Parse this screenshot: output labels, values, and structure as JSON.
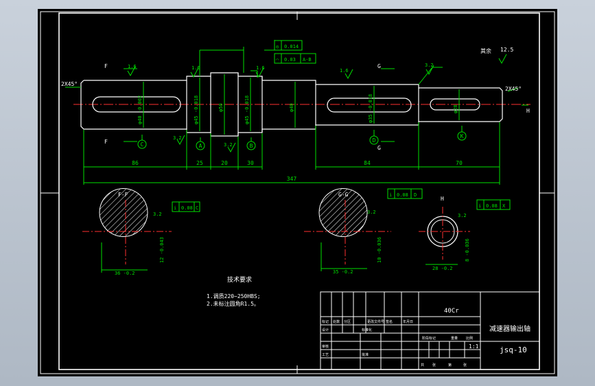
{
  "drawing": {
    "part_name": "减速器输出轴",
    "material": "40Cr",
    "drawing_no": "jsq-10",
    "scale": "1:1",
    "surface_finish_rest": "其余",
    "surface_finish_rest_value": "12.5",
    "tech_requirements_title": "技术要求",
    "tech_requirements": [
      "1.调质220~250HBS;",
      "2.未标注圆角R1.5。"
    ]
  },
  "front_view": {
    "chamfer_left": "2X45°",
    "chamfer_right": "2X45°",
    "diameters": [
      "φ40 -0.002",
      "φ45 -0.018",
      "φ50",
      "φ45 -0.018",
      "φ40",
      "φ35 -0.018",
      "φ28"
    ],
    "dim_lengths": [
      "86",
      "25",
      "20",
      "30",
      "84",
      "70"
    ],
    "dim_total": "347",
    "roughness_values": [
      "1.6",
      "1.6",
      "1.6",
      "1.6",
      "3.2",
      "3.2",
      "3.2"
    ],
    "datums": [
      "C",
      "A",
      "B",
      "D",
      "K"
    ],
    "section_marks": [
      "F",
      "F",
      "G",
      "G",
      "H"
    ]
  },
  "tolerance_frames": [
    {
      "symbol": "◎",
      "value": "0.014",
      "datum": ""
    },
    {
      "symbol": "⌒",
      "value": "0.03",
      "datum": "A-B"
    }
  ],
  "sections": [
    {
      "title": "F-F",
      "tol_symbol": "i",
      "tol_value": "0.08",
      "tol_datum": "C",
      "roughness": "3.2",
      "dim_bottom": "36 -0.2",
      "dim_key": "12 -0.043"
    },
    {
      "title": "G-G",
      "tol_symbol": "i",
      "tol_value": "0.08",
      "tol_datum": "D",
      "roughness": "3.2",
      "dim_bottom": "35 -0.2",
      "dim_key": "10 -0.036"
    },
    {
      "title": "H",
      "tol_symbol": "i",
      "tol_value": "0.08",
      "tol_datum": "X",
      "roughness": "3.2",
      "dim_bottom": "28 -0.2",
      "dim_key": "8 -0.036"
    }
  ],
  "title_block": {
    "row_labels": [
      "标记",
      "处数",
      "分区",
      "更改文件号",
      "签名",
      "年月日"
    ],
    "role_labels": [
      "设计",
      "标准化",
      "审核",
      "工艺",
      "批准"
    ],
    "stage_labels": [
      "阶段标记",
      "重量",
      "比例"
    ],
    "sheet_labels": [
      "共",
      "张",
      "第",
      "张"
    ]
  }
}
